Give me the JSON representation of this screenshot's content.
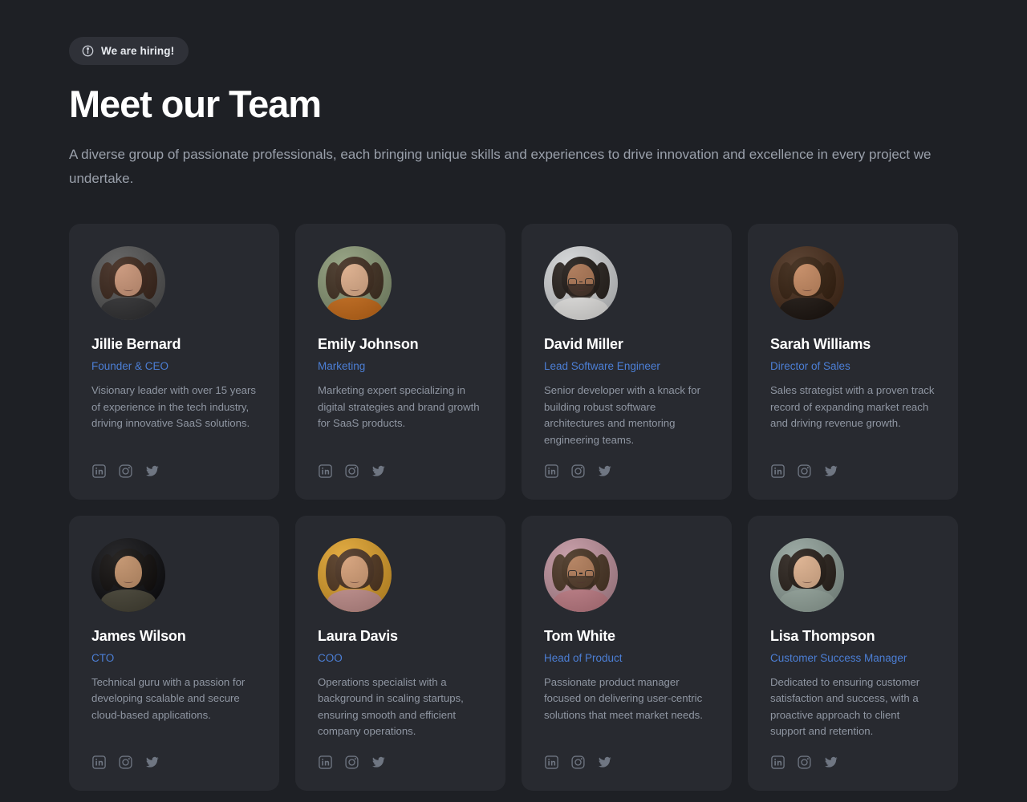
{
  "header": {
    "badge": {
      "icon": "info-icon",
      "label": "We are hiring!"
    },
    "title": "Meet our Team",
    "subtitle": "A diverse group of passionate professionals, each bringing unique skills and experiences to drive innovation and excellence in every project we undertake."
  },
  "colors": {
    "page_background": "#1e2025",
    "card_background": "#282a30",
    "badge_background": "#2f3138",
    "title": "#ffffff",
    "subtitle": "#9aa0ab",
    "role_accent": "#4c7fd6",
    "bio": "#8f96a2",
    "social_icon": "#6f7682"
  },
  "social_links": [
    {
      "name": "linkedin",
      "label": "LinkedIn"
    },
    {
      "name": "instagram",
      "label": "Instagram"
    },
    {
      "name": "twitter",
      "label": "Twitter"
    }
  ],
  "team": [
    {
      "name": "Jillie Bernard",
      "role": "Founder & CEO",
      "bio": "Visionary leader with over 15 years of experience in the tech industry, driving innovative SaaS solutions.",
      "avatar": {
        "bg": "#575757",
        "skin": "#c89274",
        "hair": "#3a2418",
        "clothes": "#38383a"
      }
    },
    {
      "name": "Emily Johnson",
      "role": "Marketing",
      "bio": "Marketing expert specializing in digital strategies and brand growth for SaaS products.",
      "avatar": {
        "bg": "#8d9b79",
        "skin": "#dcab87",
        "hair": "#3d2a1c",
        "clothes": "#d3741f"
      }
    },
    {
      "name": "David Miller",
      "role": "Lead Software Engineer",
      "bio": "Senior developer with a knack for building robust software architectures and mentoring engineering teams.",
      "avatar": {
        "bg": "#d3d5d7",
        "skin": "#a9724f",
        "hair": "#1d1713",
        "clothes": "#f2f1ef",
        "glasses": true,
        "beard": "#2a1f18"
      }
    },
    {
      "name": "Sarah Williams",
      "role": "Director of Sales",
      "bio": "Sales strategist with a proven track record of expanding market reach and driving revenue growth.",
      "avatar": {
        "bg": "#4a2f1d",
        "skin": "#c3865d",
        "hair": "#35200f",
        "clothes": "#221a15"
      }
    },
    {
      "name": "James Wilson",
      "role": "CTO",
      "bio": "Technical guru with a passion for developing scalable and secure cloud-based applications.",
      "avatar": {
        "bg": "#111114",
        "skin": "#c08e66",
        "hair": "#100d0b",
        "clothes": "#4d4a3c"
      }
    },
    {
      "name": "Laura Davis",
      "role": "COO",
      "bio": "Operations specialist with a background in scaling startups, ensuring smooth and efficient company operations.",
      "avatar": {
        "bg": "#e0a32e",
        "skin": "#d49d74",
        "hair": "#4a3220",
        "clothes": "#cf9a97"
      }
    },
    {
      "name": "Tom White",
      "role": "Head of Product",
      "bio": "Passionate product manager focused on delivering user-centric solutions that meet market needs.",
      "avatar": {
        "bg": "#c295a0",
        "skin": "#b07a56",
        "hair": "#44301f",
        "clothes": "#cd8790",
        "glasses": true,
        "beard": "#3a2a1c"
      }
    },
    {
      "name": "Lisa Thompson",
      "role": "Customer Success Manager",
      "bio": "Dedicated to ensuring customer satisfaction and success, with a proactive approach to client support and retention.",
      "avatar": {
        "bg": "#93a39c",
        "skin": "#dcae8a",
        "hair": "#231a14",
        "clothes": "#9fb0a7"
      }
    }
  ]
}
